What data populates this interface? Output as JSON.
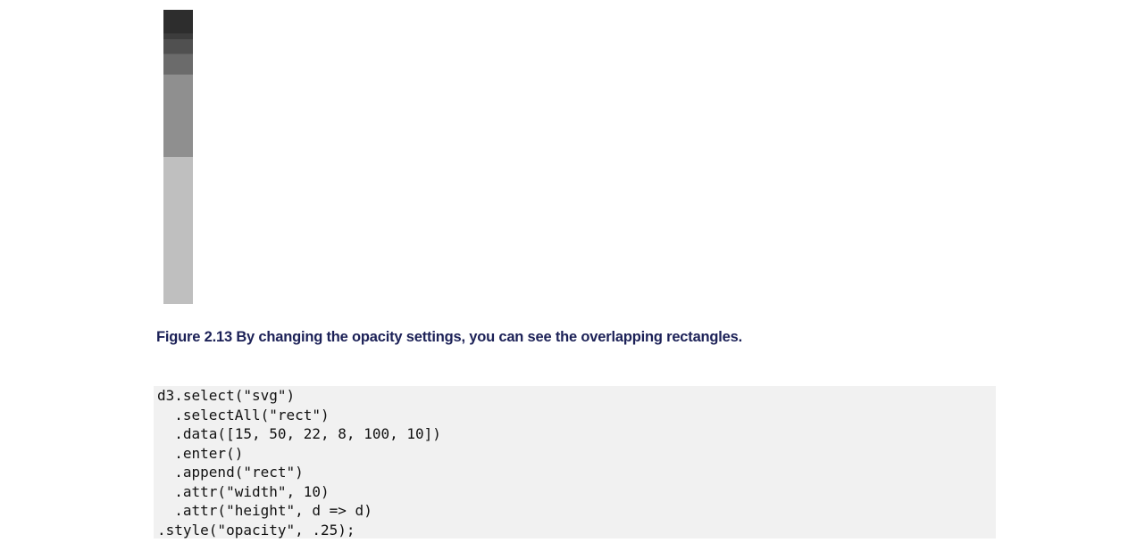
{
  "figure": {
    "rect_values": [
      15,
      50,
      22,
      8,
      100,
      10
    ],
    "rect_width": 10,
    "rect_opacity": 0.25,
    "rect_color": "#000000"
  },
  "caption": {
    "label": "Figure 2.13",
    "text": "By changing the opacity settings, you can see the overlapping rectangles."
  },
  "code": {
    "lines": [
      "d3.select(\"svg\")",
      "  .selectAll(\"rect\")",
      "  .data([15, 50, 22, 8, 100, 10])",
      "  .enter()",
      "  .append(\"rect\")",
      "  .attr(\"width\", 10)",
      "  .attr(\"height\", d => d)",
      ".style(\"opacity\", .25);"
    ]
  },
  "colors": {
    "caption": "#1c2157",
    "code_background": "#f1f1f1"
  }
}
